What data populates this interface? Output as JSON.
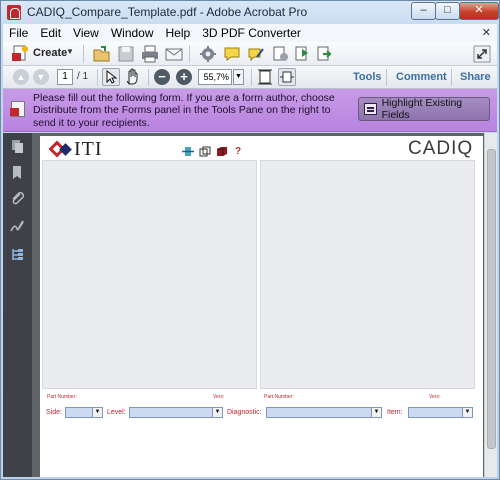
{
  "window": {
    "title": "CADIQ_Compare_Template.pdf - Adobe Acrobat Pro",
    "controls": {
      "minimize": "–",
      "maximize": "□",
      "close": "✕"
    }
  },
  "menu": {
    "items": [
      "File",
      "Edit",
      "View",
      "Window",
      "Help",
      "3D PDF Converter"
    ],
    "close_glyph": "✕"
  },
  "toolbar": {
    "create_label": "Create",
    "create_caret": "▼",
    "icons": [
      "create-pdf-icon",
      "open-folder-icon",
      "save-icon",
      "print-icon",
      "email-icon",
      "settings-gear-icon",
      "comment-icon",
      "sign-icon",
      "stamp-icon",
      "export-icon",
      "share-icon",
      "expand-icon"
    ]
  },
  "nav": {
    "prev": "▲",
    "next": "▼",
    "page_current": "1",
    "page_total": "/ 1",
    "zoom_value": "55,7%",
    "zoom_drop": "▼",
    "zoom_out": "−",
    "zoom_in": "+",
    "links": {
      "tools": "Tools",
      "comment": "Comment",
      "share": "Share"
    }
  },
  "banner": {
    "message": "Please fill out the following form. If you are a form author, choose Distribute from the Forms panel in the Tools Pane on the right to send it to your recipients.",
    "highlight_button": "Highlight Existing Fields"
  },
  "document": {
    "logo_text": "ITI",
    "brand": "CADIQ",
    "help_glyph": "?",
    "left_part_number": "Part Number:",
    "left_vers": "Vers:",
    "right_part_number": "Part Number:",
    "right_vers": "Vers:",
    "fields": {
      "side": "Side:",
      "level": "Level:",
      "diagnostic": "Diagnostic:",
      "item": "Item:"
    },
    "dropdown_arrow": "▼"
  },
  "colors": {
    "banner_bg": "#c89be8",
    "doc_bg": "#5f6368",
    "accent_red": "#c1272d",
    "link_blue": "#3b6fa3",
    "field_fill": "#ccd9f1"
  }
}
